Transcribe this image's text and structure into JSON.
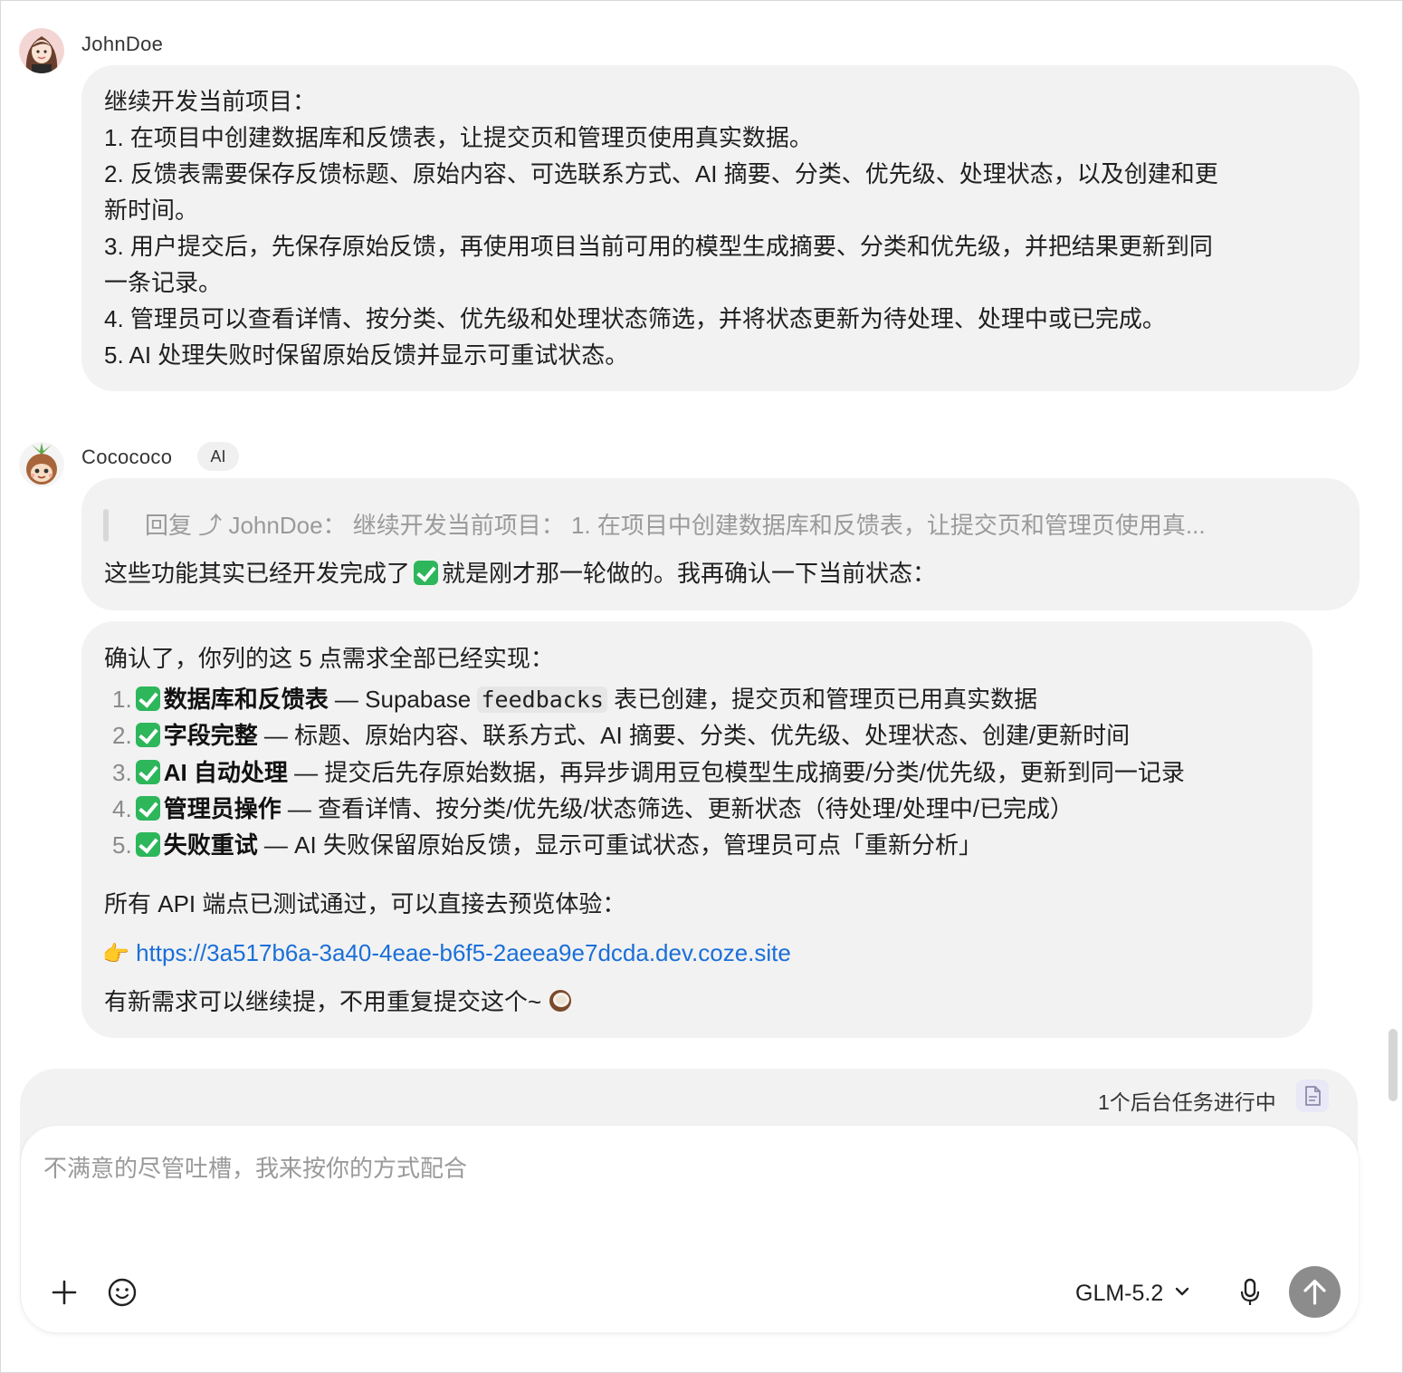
{
  "user_message": {
    "author": "JohnDoe",
    "lines": [
      "继续开发当前项目：",
      "1. 在项目中创建数据库和反馈表，让提交页和管理页使用真实数据。",
      "2. 反馈表需要保存反馈标题、原始内容、可选联系方式、AI 摘要、分类、优先级、处理状态，以及创建和更",
      "新时间。",
      "3. 用户提交后，先保存原始反馈，再使用项目当前可用的模型生成摘要、分类和优先级，并把结果更新到同",
      "一条记录。",
      "4. 管理员可以查看详情、按分类、优先级和处理状态筛选，并将状态更新为待处理、处理中或已完成。",
      "5. AI 处理失败时保留原始反馈并显示可重试状态。"
    ]
  },
  "ai_message": {
    "author": "Cocococo",
    "badge": "AI",
    "reply_quote": "回复 ⤴ JohnDoe：  继续开发当前项目：  1. 在项目中创建数据库和反馈表，让提交页和管理页使用真...",
    "intro_before": "这些功能其实已经开发完成了",
    "intro_after": "就是刚才那一轮做的。我再确认一下当前状态：",
    "confirm": "确认了，你列的这 5 点需求全部已经实现：",
    "items": [
      {
        "num": "1.",
        "title": "数据库和反馈表",
        "text_before": " — Supabase ",
        "code": "feedbacks",
        "text_after": " 表已创建，提交页和管理页已用真实数据"
      },
      {
        "num": "2.",
        "title": "字段完整",
        "text_before": " — 标题、原始内容、联系方式、AI 摘要、分类、优先级、处理状态、创建/更新时间",
        "code": "",
        "text_after": ""
      },
      {
        "num": "3.",
        "title": "AI 自动处理",
        "text_before": " — 提交后先存原始数据，再异步调用豆包模型生成摘要/分类/优先级，更新到同一记录",
        "code": "",
        "text_after": ""
      },
      {
        "num": "4.",
        "title": "管理员操作",
        "text_before": " — 查看详情、按分类/优先级/状态筛选、更新状态（待处理/处理中/已完成）",
        "code": "",
        "text_after": ""
      },
      {
        "num": "5.",
        "title": "失败重试",
        "text_before": " — AI 失败保留原始反馈，显示可重试状态，管理员可点「重新分析」",
        "code": "",
        "text_after": ""
      }
    ],
    "api_text": "所有 API 端点已测试通过，可以直接去预览体验：",
    "link_emoji": "👉",
    "link": "https://3a517b6a-3a40-4eae-b6f5-2aeea9e7dcda.dev.coze.site",
    "closing": "有新需求可以继续提，不用重复提交这个~"
  },
  "composer": {
    "task_status": "1个后台任务进行中",
    "placeholder": "不满意的尽管吐槽，我来按你的方式配合",
    "model": "GLM-5.2",
    "icons": [
      "plus-icon",
      "emoji-icon",
      "chevron-down-icon",
      "microphone-icon",
      "send-arrow-icon",
      "document-icon"
    ]
  },
  "colors": {
    "bubble": "#f2f2f2",
    "link": "#1a6fd9",
    "check": "#2db65a",
    "send_button": "#8c8c8c"
  }
}
